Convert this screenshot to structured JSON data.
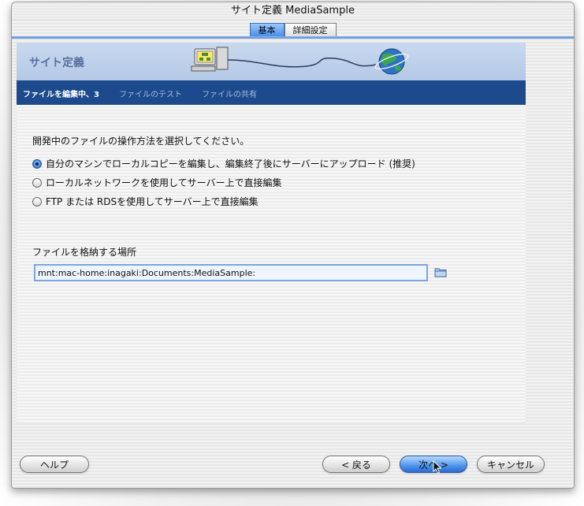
{
  "window": {
    "title": "サイト定義 MediaSample"
  },
  "tabs": [
    {
      "label": "基本",
      "active": true
    },
    {
      "label": "詳細設定",
      "active": false
    }
  ],
  "header": {
    "title": "サイト定義"
  },
  "steps": [
    {
      "label": "ファイルを編集中、3",
      "current": true
    },
    {
      "label": "ファイルのテスト",
      "current": false
    },
    {
      "label": "ファイルの共有",
      "current": false
    }
  ],
  "prompt": "開発中のファイルの操作方法を選択してください。",
  "options": [
    {
      "label": "自分のマシンでローカルコピーを編集し、編集終了後にサーバーにアップロード (推奨)",
      "selected": true
    },
    {
      "label": "ローカルネットワークを使用してサーバー上で直接編集",
      "selected": false
    },
    {
      "label": "FTP または RDSを使用してサーバー上で直接編集",
      "selected": false
    }
  ],
  "storage": {
    "label": "ファイルを格納する場所",
    "path": "mnt:mac-home:inagaki:Documents:MediaSample:"
  },
  "buttons": {
    "help": "ヘルプ",
    "back": "< 戻る",
    "next": "次へ >",
    "cancel": "キャンセル"
  },
  "colors": {
    "accent": "#3f89e6",
    "step_bar": "#1c4a8c",
    "header_bg": "#c9d9ef"
  },
  "icons": [
    "computer-icon",
    "globe-icon",
    "folder-icon",
    "cursor-icon"
  ]
}
